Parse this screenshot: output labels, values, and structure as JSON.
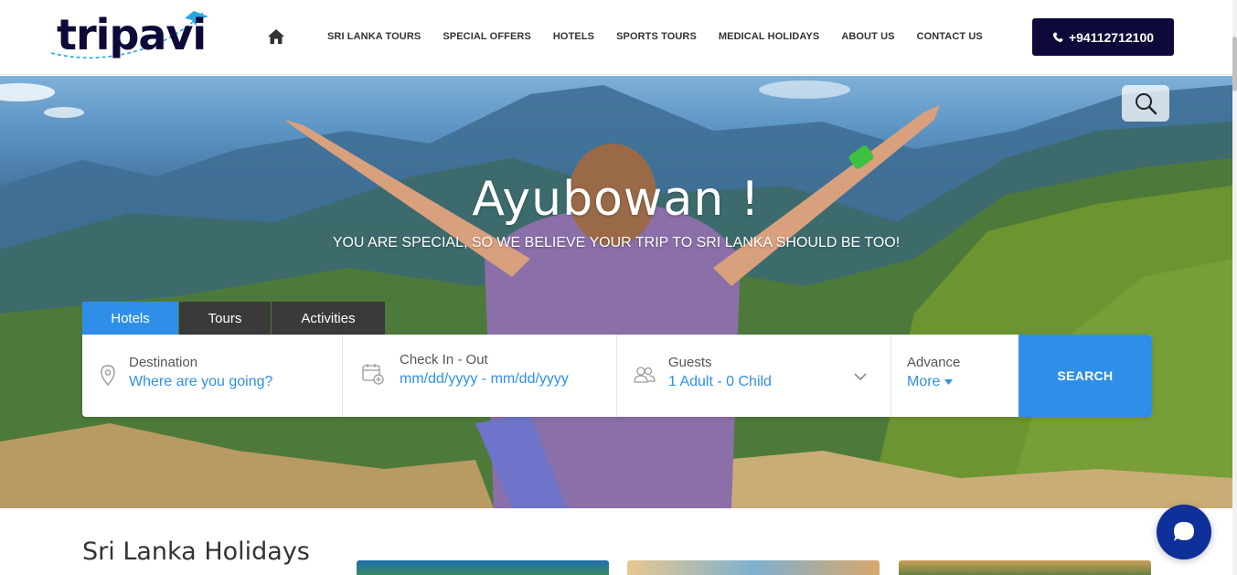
{
  "brand": {
    "logo_text": "tripavi"
  },
  "nav": {
    "items": [
      "SRI LANKA TOURS",
      "SPECIAL OFFERS",
      "HOTELS",
      "SPORTS TOURS",
      "MEDICAL HOLIDAYS",
      "ABOUT US",
      "CONTACT US"
    ]
  },
  "header": {
    "phone": "+94112712100"
  },
  "hero": {
    "title": "Ayubowan !",
    "subtitle": "YOU ARE SPECIAL, SO WE BELIEVE YOUR TRIP TO SRI LANKA SHOULD BE TOO!"
  },
  "search": {
    "tabs": [
      "Hotels",
      "Tours",
      "Activities"
    ],
    "active_tab": "Hotels",
    "destination": {
      "label": "Destination",
      "value": "Where are you going?"
    },
    "checkin": {
      "label": "Check In - Out",
      "value": "mm/dd/yyyy - mm/dd/yyyy"
    },
    "guests": {
      "label": "Guests",
      "value": "1 Adult - 0 Child"
    },
    "advance": {
      "label": "Advance",
      "value": "More"
    },
    "button": "SEARCH"
  },
  "section": {
    "title": "Sri Lanka Holidays"
  },
  "colors": {
    "accent": "#2f8fe8",
    "dark": "#0d0a3a",
    "chat": "#0f2f9a"
  }
}
